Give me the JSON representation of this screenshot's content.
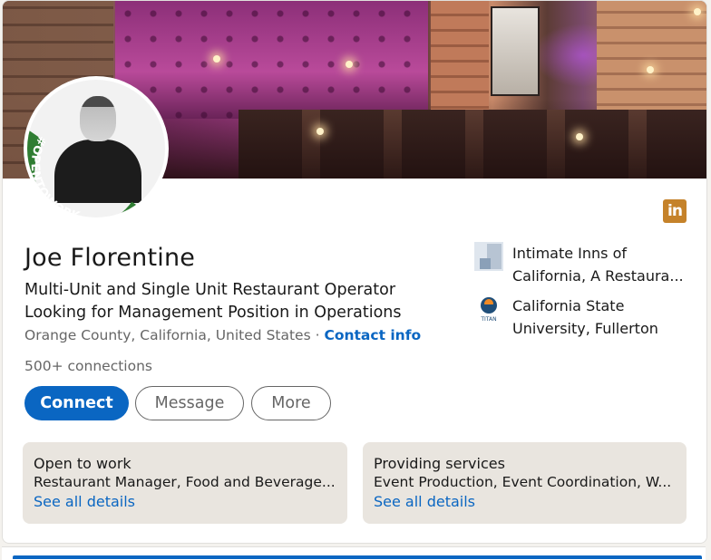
{
  "profile": {
    "name": "Joe Florentine",
    "headline_line1": "Multi-Unit and Single Unit Restaurant Operator",
    "headline_line2": "Looking for Management Position in Operations",
    "location": "Orange County, California, United States",
    "location_separator": " · ",
    "contact_info_label": "Contact info",
    "connections": "500+ connections",
    "open_to_work_badge": "#OPENTOWORK"
  },
  "actions": {
    "connect_label": "Connect",
    "message_label": "Message",
    "more_label": "More"
  },
  "experience": [
    {
      "line1": "Intimate Inns of",
      "line2": "California, A Restaura..."
    },
    {
      "line1": "California State",
      "line2": "University, Fullerton"
    }
  ],
  "education_logo_text": "TITAN",
  "linkedin_logo_text": "in",
  "open_to_work": {
    "title": "Open to work",
    "roles": "Restaurant Manager, Food and Beverage...",
    "link": "See all details"
  },
  "providing_services": {
    "title": "Providing services",
    "services": "Event Production, Event Coordination, W...",
    "link": "See all details"
  },
  "colors": {
    "accent": "#0a66c2",
    "open_to_work_green": "#2f7d32",
    "linkedin_badge": "#c5822a",
    "panel_bg": "#e9e5df"
  }
}
